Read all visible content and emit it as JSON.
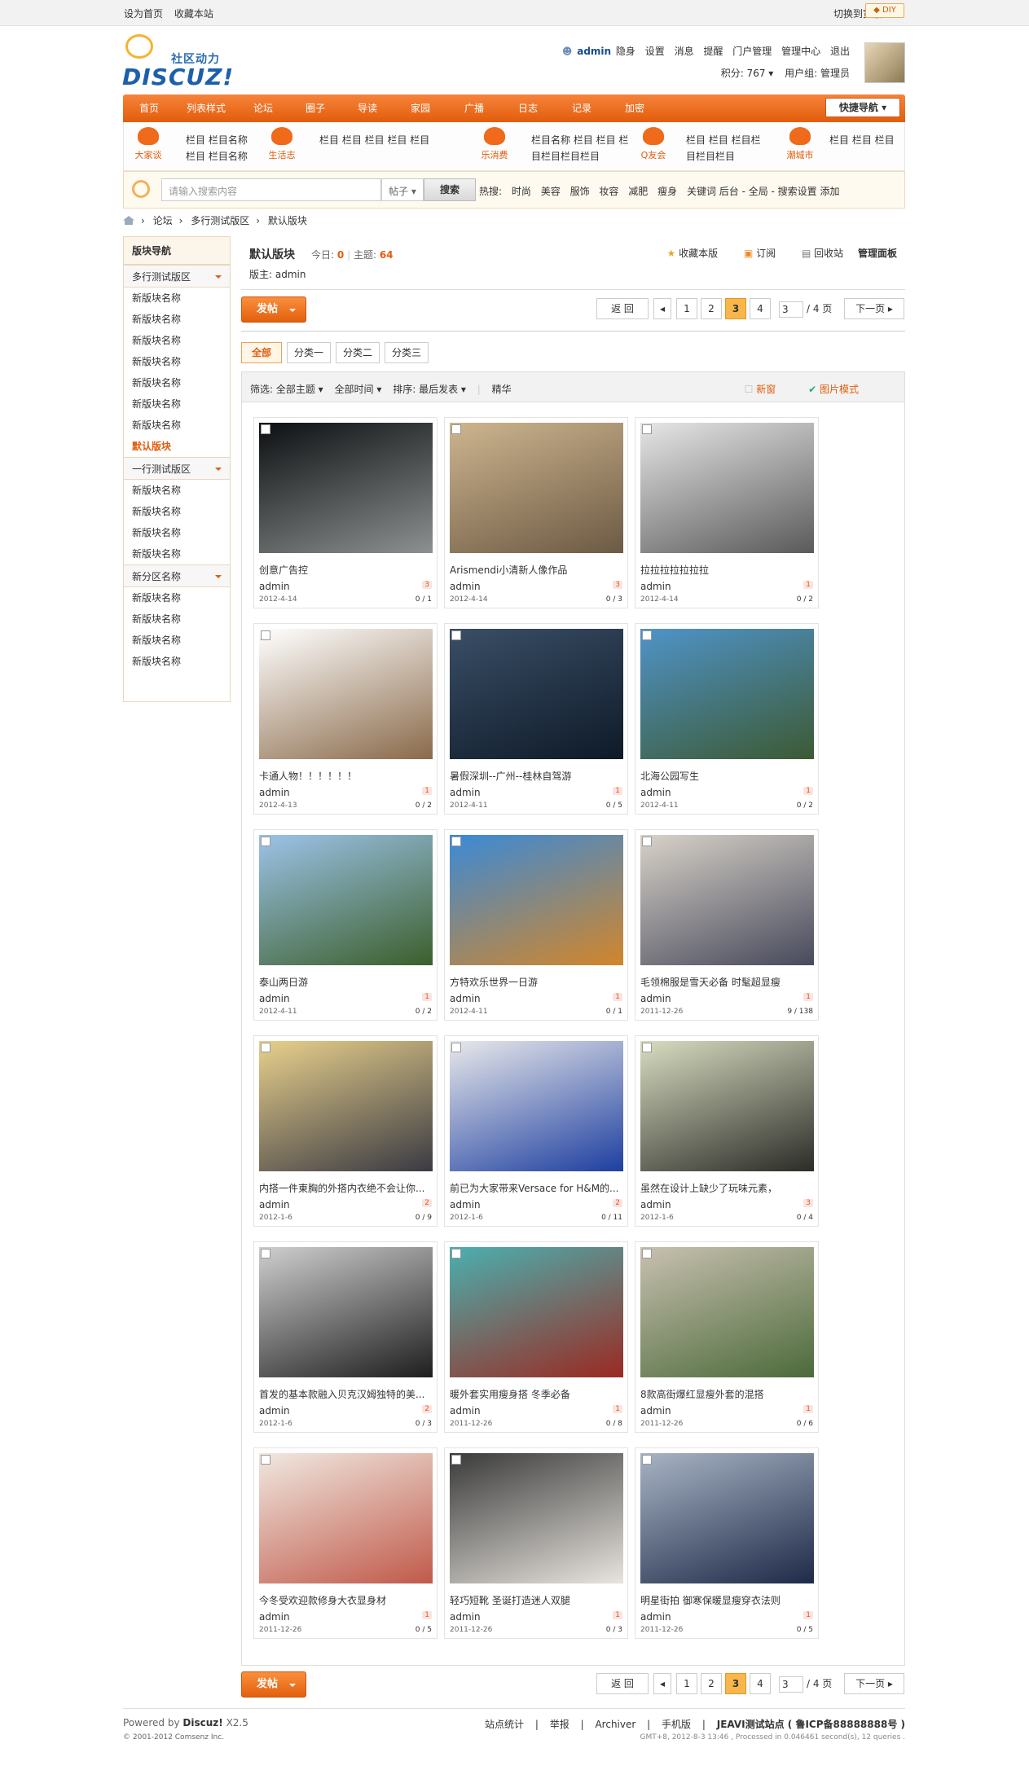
{
  "topbar": {
    "sethome": "设为首页",
    "fav": "收藏本站",
    "switch": "切换到宽版",
    "diy": "DIY"
  },
  "logo": {
    "cn": "社区动力",
    "en": "DISCUZ!"
  },
  "user": {
    "name": "admin",
    "hide": "隐身",
    "links": [
      "设置",
      "消息",
      "提醒",
      "门户管理",
      "管理中心",
      "退出"
    ],
    "credits": "积分: 767",
    "group": "用户组: 管理员"
  },
  "nav": {
    "items": [
      "首页",
      "列表样式",
      "论坛",
      "圈子",
      "导读",
      "家园",
      "广播",
      "日志",
      "记录",
      "加密"
    ],
    "quick": "快捷导航"
  },
  "subnav": {
    "icons": [
      {
        "label": "大家谈"
      },
      {
        "label": "生活志"
      },
      {
        "label": "乐消费"
      },
      {
        "label": "Q友会"
      },
      {
        "label": "潮城市"
      }
    ],
    "texts": [
      "栏目 栏目名称",
      "栏目 栏目名称",
      "栏目 栏目 栏目 栏目 栏目",
      "栏目名称 栏目 栏目 栏",
      "目栏目栏目栏目",
      "栏目 栏目 栏目栏",
      "目栏目栏目",
      "栏目 栏目 栏目"
    ]
  },
  "search": {
    "placeholder": "请输入搜索内容",
    "type": "帖子",
    "button": "搜索",
    "hot_label": "热搜:",
    "hot": [
      "时尚",
      "美容",
      "服饰",
      "妆容",
      "减肥",
      "瘦身",
      "关键词 后台 - 全局 - 搜索设置 添加"
    ]
  },
  "crumb": [
    "论坛",
    "多行测试版区",
    "默认版块"
  ],
  "side": {
    "title": "版块导航",
    "groups": [
      {
        "name": "多行测试版区",
        "items": [
          "新版块名称",
          "新版块名称",
          "新版块名称",
          "新版块名称",
          "新版块名称",
          "新版块名称",
          "新版块名称",
          "默认版块"
        ]
      },
      {
        "name": "一行测试版区",
        "items": [
          "新版块名称",
          "新版块名称",
          "新版块名称",
          "新版块名称"
        ]
      },
      {
        "name": "新分区名称",
        "items": [
          "新版块名称",
          "新版块名称",
          "新版块名称",
          "新版块名称"
        ]
      }
    ]
  },
  "forum": {
    "title": "默认版块",
    "today_label": "今日:",
    "today": "0",
    "sep": "|",
    "topics_label": "主题:",
    "topics": "64",
    "moderator": "版主: admin",
    "actions": [
      "收藏本版",
      "订阅",
      "回收站",
      "管理面板"
    ]
  },
  "post_label": "发帖",
  "pager": {
    "back": "返 回",
    "pages": [
      "1",
      "2",
      "3",
      "4"
    ],
    "current": "3",
    "jump": "3",
    "total": "/ 4 页",
    "next": "下一页"
  },
  "cats": [
    "全部",
    "分类一",
    "分类二",
    "分类三"
  ],
  "filter": {
    "left": [
      "筛选: 全部主题",
      "全部时间",
      "排序: 最后发表",
      "精华"
    ],
    "new": "新窗",
    "picmode": "图片模式"
  },
  "posts": [
    {
      "title": "创意广告控",
      "author": "admin",
      "date": "2012-4-14",
      "replies": "3",
      "views": "0 / 1",
      "c1": "#0c1012",
      "c2": "#8d9090"
    },
    {
      "title": "Arismendi小清新人像作品",
      "author": "admin",
      "date": "2012-4-14",
      "replies": "3",
      "views": "0 / 3",
      "c1": "#cdb58f",
      "c2": "#6d5a44"
    },
    {
      "title": "拉拉拉拉拉拉拉",
      "author": "admin",
      "date": "2012-4-14",
      "replies": "1",
      "views": "0 / 2",
      "c1": "#e6e6e6",
      "c2": "#5a5a5a"
    },
    {
      "title": "卡通人物！！！！！！",
      "author": "admin",
      "date": "2012-4-13",
      "replies": "1",
      "views": "0 / 2",
      "c1": "#ffffff",
      "c2": "#8a6a4a"
    },
    {
      "title": "暑假深圳--广州--桂林自驾游",
      "author": "admin",
      "date": "2012-4-11",
      "replies": "1",
      "views": "0 / 5",
      "c1": "#3a4e66",
      "c2": "#0e1a28"
    },
    {
      "title": "北海公园写生",
      "author": "admin",
      "date": "2012-4-11",
      "replies": "1",
      "views": "0 / 2",
      "c1": "#4f93c8",
      "c2": "#3c5a34"
    },
    {
      "title": "泰山两日游",
      "author": "admin",
      "date": "2012-4-11",
      "replies": "1",
      "views": "0 / 2",
      "c1": "#9cc3e8",
      "c2": "#3c5f2c"
    },
    {
      "title": "方特欢乐世界一日游",
      "author": "admin",
      "date": "2012-4-11",
      "replies": "1",
      "views": "0 / 1",
      "c1": "#3a8ad8",
      "c2": "#d2862a"
    },
    {
      "title": "毛领棉服是雪天必备 时髦超显瘦",
      "author": "admin",
      "date": "2011-12-26",
      "replies": "1",
      "views": "9 / 138",
      "c1": "#d8d2c8",
      "c2": "#484a5c"
    },
    {
      "title": "内搭一件東胸的外搭内衣绝不会让你...",
      "author": "admin",
      "date": "2012-1-6",
      "replies": "2",
      "views": "0 / 9",
      "c1": "#e8d08c",
      "c2": "#3a3a42"
    },
    {
      "title": "前已为大家带来Versace for H&M的...",
      "author": "admin",
      "date": "2012-1-6",
      "replies": "2",
      "views": "0 / 11",
      "c1": "#e8e8ea",
      "c2": "#1e3fa0"
    },
    {
      "title": "虽然在设计上缺少了玩味元素，",
      "author": "admin",
      "date": "2012-1-6",
      "replies": "3",
      "views": "0 / 4",
      "c1": "#d8dcc0",
      "c2": "#2c2c28"
    },
    {
      "title": "首发的基本款融入贝克汉姆独特的美...",
      "author": "admin",
      "date": "2012-1-6",
      "replies": "2",
      "views": "0 / 3",
      "c1": "#cfcfcf",
      "c2": "#1e1e1e"
    },
    {
      "title": "暖外套实用瘦身搭 冬季必备",
      "author": "admin",
      "date": "2011-12-26",
      "replies": "1",
      "views": "0 / 8",
      "c1": "#4ab0b0",
      "c2": "#9a2a22"
    },
    {
      "title": "8款高街爆红显瘦外套的混搭",
      "author": "admin",
      "date": "2011-12-26",
      "replies": "1",
      "views": "0 / 6",
      "c1": "#c8c0b0",
      "c2": "#4c6a3a"
    },
    {
      "title": "今冬受欢迎款修身大衣显身材",
      "author": "admin",
      "date": "2011-12-26",
      "replies": "1",
      "views": "0 / 5",
      "c1": "#f0e8e0",
      "c2": "#c05a4a"
    },
    {
      "title": "轻巧短靴 圣诞打造迷人双腿",
      "author": "admin",
      "date": "2011-12-26",
      "replies": "1",
      "views": "0 / 3",
      "c1": "#3a3a3a",
      "c2": "#e8e4de"
    },
    {
      "title": "明星街拍 御寒保暖显瘦穿衣法则",
      "author": "admin",
      "date": "2011-12-26",
      "replies": "1",
      "views": "0 / 5",
      "c1": "#a8b4c4",
      "c2": "#1e2a48"
    }
  ],
  "footer": {
    "powered": "Powered by",
    "brand": "Discuz!",
    "ver": "X2.5",
    "copy": "© 2001-2012 Comsenz Inc.",
    "links": [
      "站点统计",
      "|",
      "举报",
      "|",
      "Archiver",
      "|",
      "手机版",
      "|",
      "JEAVI测试站点 ( 鲁ICP备88888888号 )"
    ],
    "gmt": "GMT+8, 2012-8-3 13:46 , Processed in 0.046461 second(s), 12 queries ."
  }
}
